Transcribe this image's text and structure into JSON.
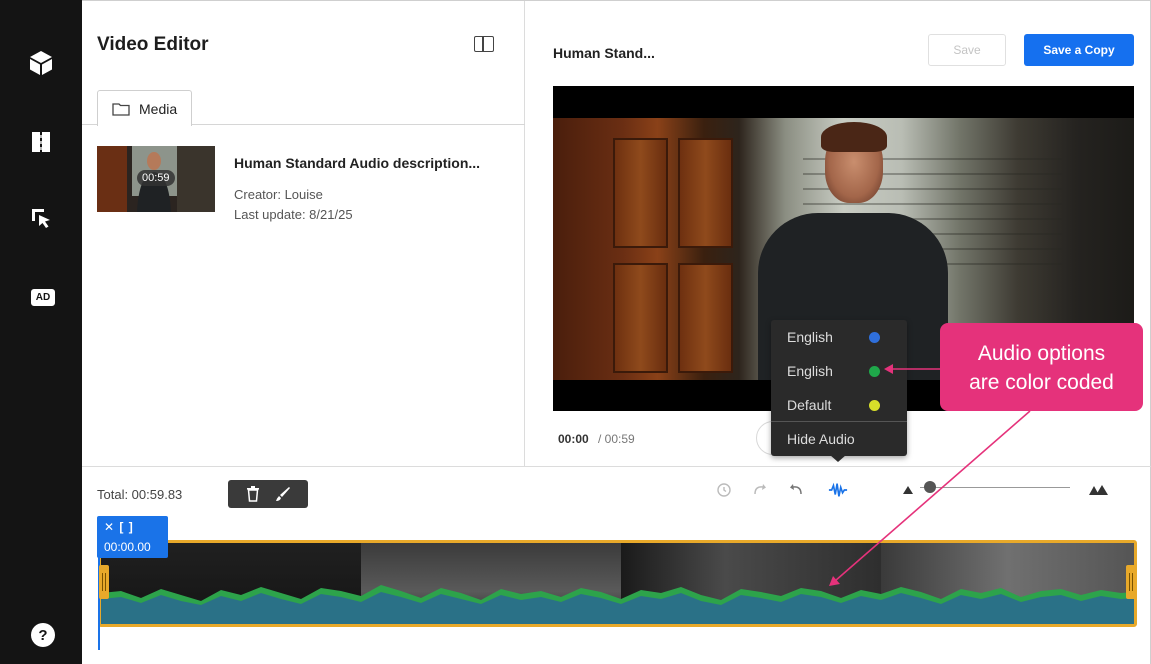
{
  "sidebar": {
    "items": [
      {
        "icon": "cube-icon"
      },
      {
        "icon": "film-strip-icon"
      },
      {
        "icon": "cursor-select-icon"
      },
      {
        "icon": "audio-description-icon",
        "label": "AD"
      }
    ],
    "help": {
      "icon": "help-icon",
      "label": "?"
    }
  },
  "editor": {
    "title": "Video Editor",
    "layout_icon": "panel-layout-icon",
    "tabs": [
      {
        "label": "Media",
        "icon": "folder-icon"
      }
    ],
    "media": {
      "name": "Human Standard Audio description...",
      "creator": "Creator: Louise",
      "last_update": "Last update: 8/21/25",
      "duration": "00:59"
    }
  },
  "preview": {
    "title": "Human Stand...",
    "save_label": "Save",
    "save_copy_label": "Save a Copy",
    "current_time": "00:00",
    "total_time": "/ 00:59"
  },
  "audio_menu": {
    "options": [
      {
        "label": "English",
        "color": "#2f6fdb"
      },
      {
        "label": "English",
        "color": "#1fa84a"
      },
      {
        "label": "Default",
        "color": "#d7df2a"
      }
    ],
    "hide_label": "Hide Audio"
  },
  "callout": {
    "line1": "Audio options",
    "line2": "are color coded",
    "color": "#e5327b"
  },
  "timeline": {
    "total": "Total: 00:59.83",
    "tools": [
      "trash-icon",
      "brush-icon"
    ],
    "controls": [
      "history-icon",
      "redo-icon",
      "undo-icon",
      "waveform-icon"
    ],
    "zoom_out_icon": "zoom-out-icon",
    "zoom_in_icon": "zoom-in-icon",
    "zoom_level": 0.03,
    "clip": {
      "time": "00:00.00",
      "icons": "split-trim-icons"
    },
    "accent": "#1a73e8",
    "track_border": "#e8a92a"
  }
}
